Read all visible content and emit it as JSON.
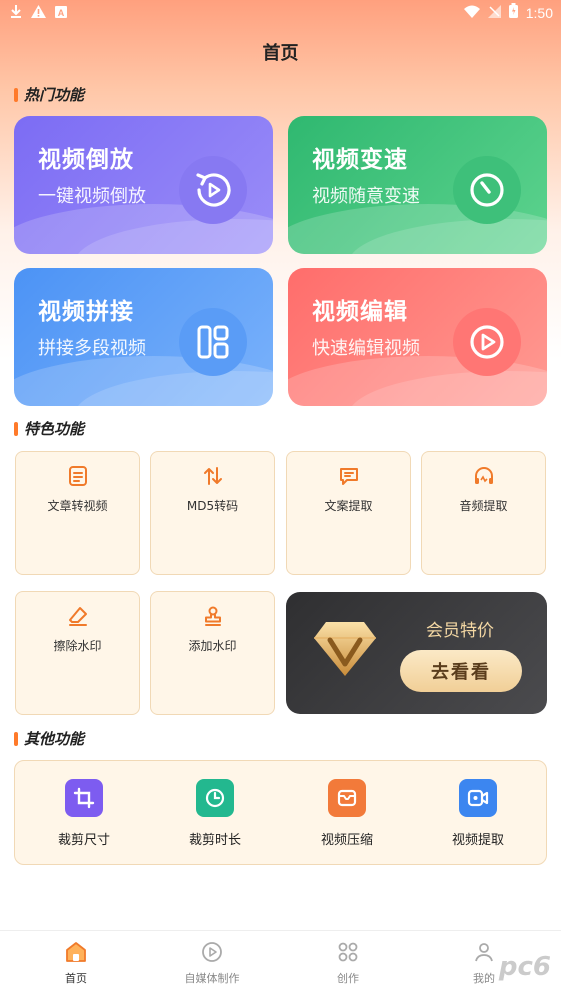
{
  "status_bar": {
    "time": "1:50"
  },
  "header": {
    "title": "首页"
  },
  "sections": {
    "hot": "热门功能",
    "featured": "特色功能",
    "other": "其他功能"
  },
  "hot_cards": [
    {
      "title": "视频倒放",
      "subtitle": "一键视频倒放",
      "icon": "rewind-icon"
    },
    {
      "title": "视频变速",
      "subtitle": "视频随意变速",
      "icon": "speed-icon"
    },
    {
      "title": "视频拼接",
      "subtitle": "拼接多段视频",
      "icon": "splice-icon"
    },
    {
      "title": "视频编辑",
      "subtitle": "快速编辑视频",
      "icon": "play-icon"
    }
  ],
  "features": [
    {
      "label": "文章转视频",
      "icon": "article-icon"
    },
    {
      "label": "MD5转码",
      "icon": "transcode-icon"
    },
    {
      "label": "文案提取",
      "icon": "message-icon"
    },
    {
      "label": "音频提取",
      "icon": "headphone-icon"
    },
    {
      "label": "擦除水印",
      "icon": "eraser-icon"
    },
    {
      "label": "添加水印",
      "icon": "stamp-icon"
    }
  ],
  "vip": {
    "title": "会员特价",
    "button": "去看看"
  },
  "other_items": [
    {
      "label": "裁剪尺寸",
      "icon": "crop-icon",
      "color": "#7d5cf0"
    },
    {
      "label": "裁剪时长",
      "icon": "clock-icon",
      "color": "#23b88f"
    },
    {
      "label": "视频压缩",
      "icon": "compress-icon",
      "color": "#f27a3a"
    },
    {
      "label": "视频提取",
      "icon": "video-extract-icon",
      "color": "#3c86f0"
    }
  ],
  "nav": [
    {
      "label": "首页",
      "icon": "home-icon",
      "active": true
    },
    {
      "label": "自媒体制作",
      "icon": "media-icon",
      "active": false
    },
    {
      "label": "创作",
      "icon": "create-icon",
      "active": false
    },
    {
      "label": "我的",
      "icon": "profile-icon",
      "active": false
    }
  ],
  "watermark": "pc6"
}
